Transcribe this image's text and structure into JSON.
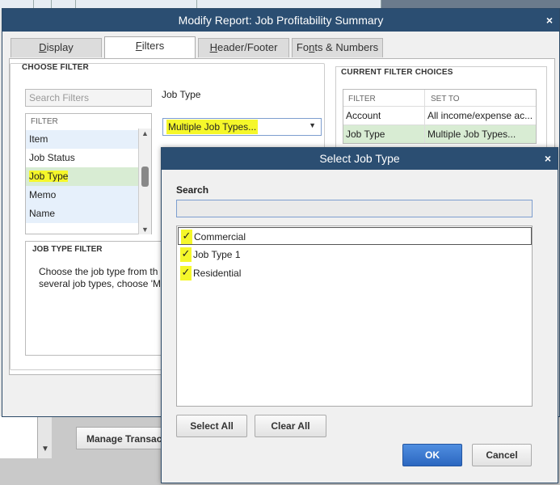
{
  "main_dialog": {
    "title": "Modify Report: Job Profitability Summary",
    "tabs": [
      {
        "label": "Display",
        "underline": "D",
        "rest": "isplay"
      },
      {
        "label": "Filters",
        "underline": "F",
        "rest": "ilters"
      },
      {
        "label": "Header/Footer",
        "underline": "H",
        "rest": "eader/Footer"
      },
      {
        "label": "Fonts & Numbers",
        "pre": "Fo",
        "underline": "n",
        "rest": "ts & Numbers"
      }
    ],
    "choose_filter": {
      "title": "CHOOSE FILTER",
      "search_placeholder": "Search Filters",
      "list_header": "FILTER",
      "items": [
        "Item",
        "Job Status",
        "Job Type",
        "Memo",
        "Name"
      ],
      "selected": "Job Type"
    },
    "field_label": "Job Type",
    "job_type_value": "Multiple Job Types...",
    "job_type_filter": {
      "title": "JOB TYPE FILTER",
      "line1": "Choose the job type from th",
      "line2": "several job types, choose 'M"
    },
    "current_filter": {
      "title": "CURRENT FILTER CHOICES",
      "col_filter": "FILTER",
      "col_set_to": "SET TO",
      "rows": [
        {
          "filter": "Account",
          "set_to": "All income/expense ac..."
        },
        {
          "filter": "Job Type",
          "set_to": "Multiple Job Types..."
        }
      ]
    }
  },
  "select_dialog": {
    "title": "Select Job Type",
    "search_label": "Search",
    "search_value": "",
    "items": [
      {
        "label": "Commercial",
        "checked": true,
        "check": "✓"
      },
      {
        "label": "Job Type 1",
        "checked": true,
        "check": "✓"
      },
      {
        "label": "Residential",
        "checked": true,
        "check": "✓"
      }
    ],
    "select_all": "Select All",
    "clear_all": "Clear All",
    "ok": "OK",
    "cancel": "Cancel"
  },
  "background": {
    "manage_button": "Manage Transactions"
  },
  "colors": {
    "titlebar": "#2b4e72",
    "highlight": "#f5f72a",
    "selected_row": "#d8ecd3",
    "primary_button": "#2c67c0"
  },
  "icons": {
    "close": "×",
    "dropdown": "▼",
    "scroll_up": "▲",
    "scroll_down": "▼"
  }
}
